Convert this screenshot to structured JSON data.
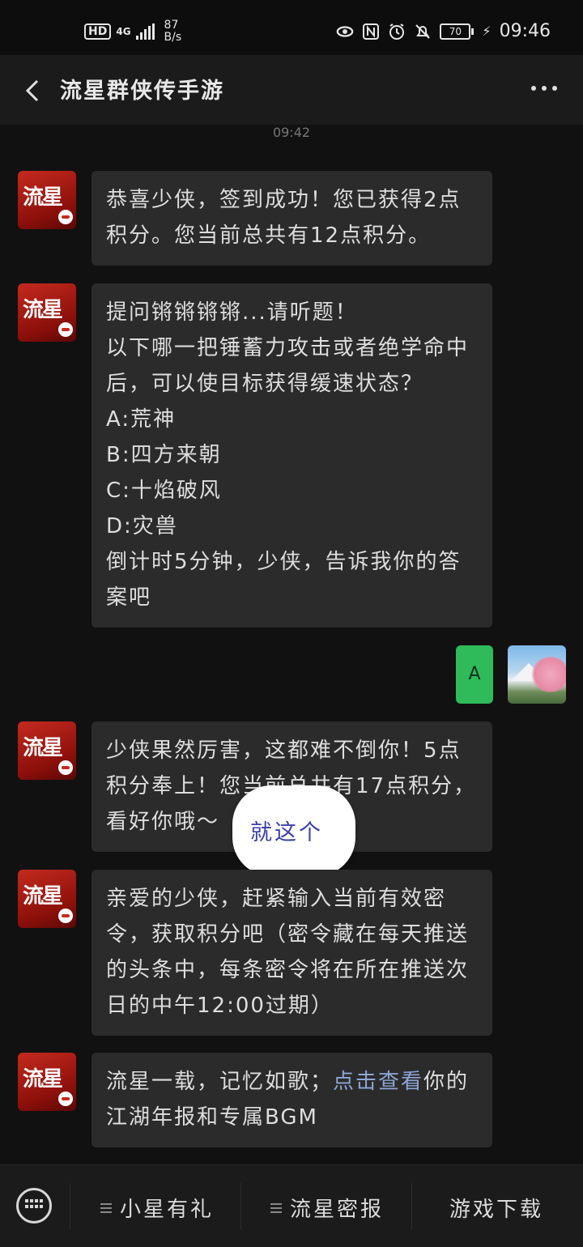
{
  "status_bar": {
    "hd": "HD",
    "signal": "4G",
    "speed_value": "87",
    "speed_unit": "B/s",
    "battery": "70",
    "time": "09:46"
  },
  "header": {
    "title": "流星群侠传手游"
  },
  "chat": {
    "timestamp": "09:42",
    "messages": [
      {
        "text": "恭喜少侠，签到成功！您已获得2点积分。您当前总共有12点积分。"
      },
      {
        "text": "提问锵锵锵锵...请听题！\n以下哪一把锤蓄力攻击或者绝学命中后，可以使目标获得缓速状态？\nA:荒神\nB:四方来朝\nC:十焰破风\nD:灾兽\n倒计时5分钟，少侠，告诉我你的答案吧"
      },
      {
        "text": "少侠果然厉害，这都难不倒你！5点积分奉上！您当前总共有17点积分，看好你哦～"
      },
      {
        "text": "亲爱的少侠，赶紧输入当前有效密令，获取积分吧（密令藏在每天推送的头条中，每条密令将在所在推送次日的中午12:00过期）"
      },
      {
        "text_before": "流星一载，记忆如歌；",
        "link": "点击查看",
        "text_after": "你的江湖年报和专属BGM"
      }
    ],
    "my_reply": "A",
    "annotation": "就这个"
  },
  "bottom_menu": {
    "items": [
      {
        "label": "小星有礼"
      },
      {
        "label": "流星密报"
      },
      {
        "label": "游戏下载"
      }
    ]
  },
  "colors": {
    "background": "#111111",
    "bubble": "#2b2b2b",
    "my_bubble": "#2fbb5a",
    "link": "#8ea6d6",
    "annotation_text": "#3a3faa"
  }
}
